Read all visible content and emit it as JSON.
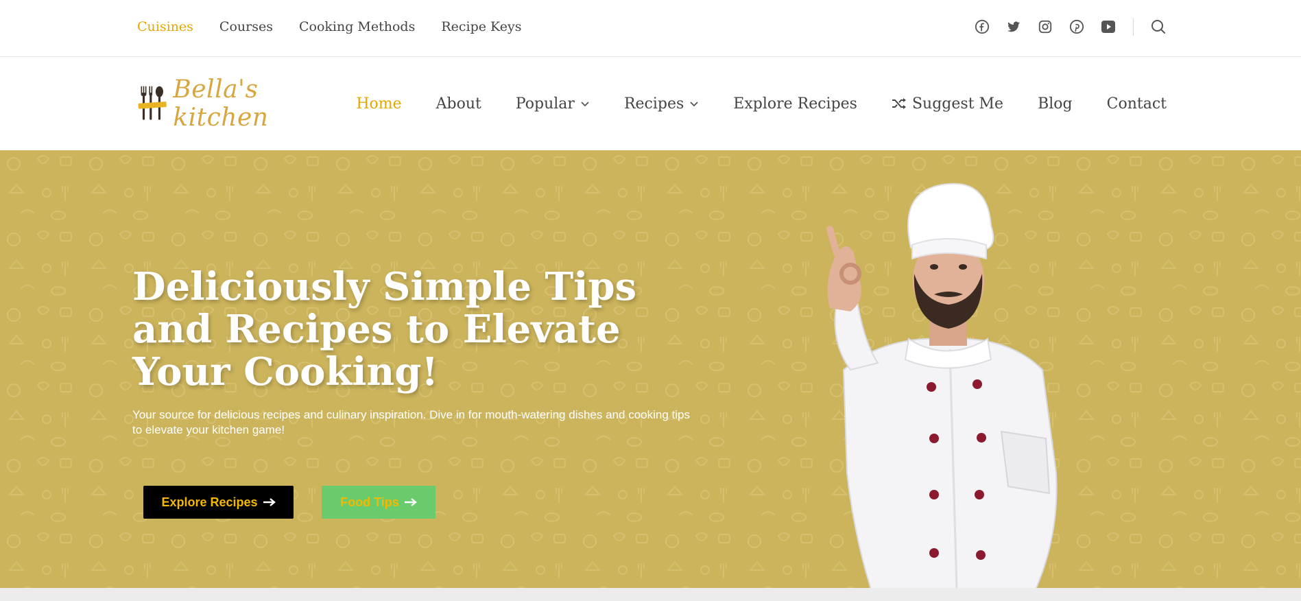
{
  "topbar": {
    "links": [
      {
        "label": "Cuisines",
        "active": true
      },
      {
        "label": "Courses",
        "active": false
      },
      {
        "label": "Cooking Methods",
        "active": false
      },
      {
        "label": "Recipe Keys",
        "active": false
      }
    ],
    "social_icons": [
      "facebook-icon",
      "twitter-icon",
      "instagram-icon",
      "pinterest-icon",
      "youtube-icon"
    ],
    "search_icon": "search-icon"
  },
  "header": {
    "logo_text": "Bella's kitchen",
    "nav": [
      {
        "label": "Home",
        "active": true
      },
      {
        "label": "About"
      },
      {
        "label": "Popular",
        "dropdown": true
      },
      {
        "label": "Recipes",
        "dropdown": true
      },
      {
        "label": "Explore Recipes"
      },
      {
        "label": "Suggest Me",
        "icon": "shuffle-icon"
      },
      {
        "label": "Blog"
      },
      {
        "label": "Contact"
      }
    ]
  },
  "hero": {
    "title": "Deliciously Simple Tips and Recipes to Elevate Your Cooking!",
    "subtitle": "Your source for delicious recipes and culinary inspiration. Dive in for mouth-watering dishes and cooking tips to elevate your kitchen game!",
    "primary_button": "Explore Recipes",
    "secondary_button": "Food Tips"
  },
  "colors": {
    "accent": "#e5a800",
    "hero_bg": "#ccb45c",
    "primary_button_bg": "#000000",
    "secondary_button_bg": "#6acb6c",
    "button_text": "#f5b800"
  }
}
